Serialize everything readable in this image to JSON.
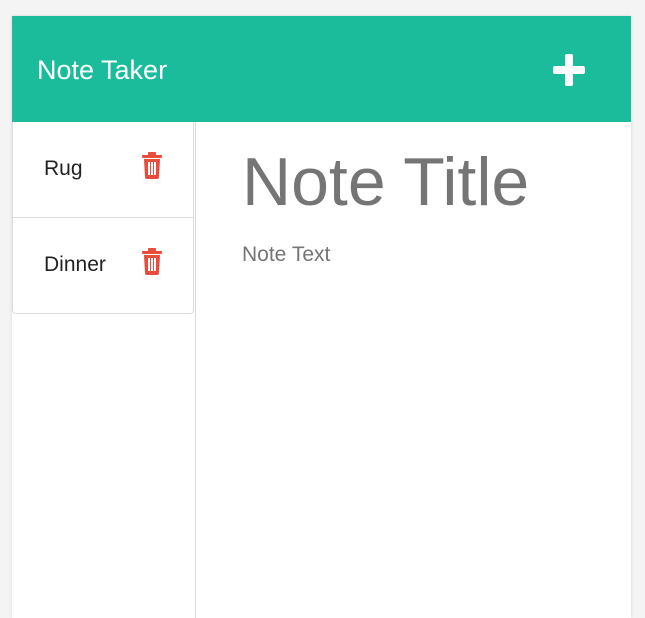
{
  "navbar": {
    "brand": "Note Taker",
    "new_note_icon": "plus-icon"
  },
  "sidebar": {
    "notes": [
      {
        "title": "Rug",
        "delete_icon": "trash-icon"
      },
      {
        "title": "Dinner",
        "delete_icon": "trash-icon"
      }
    ]
  },
  "editor": {
    "title_placeholder": "Note Title",
    "text_placeholder": "Note Text"
  },
  "colors": {
    "navbar_bg": "#1abc9c",
    "delete_icon": "#e74c3c",
    "placeholder_text": "#757575"
  }
}
